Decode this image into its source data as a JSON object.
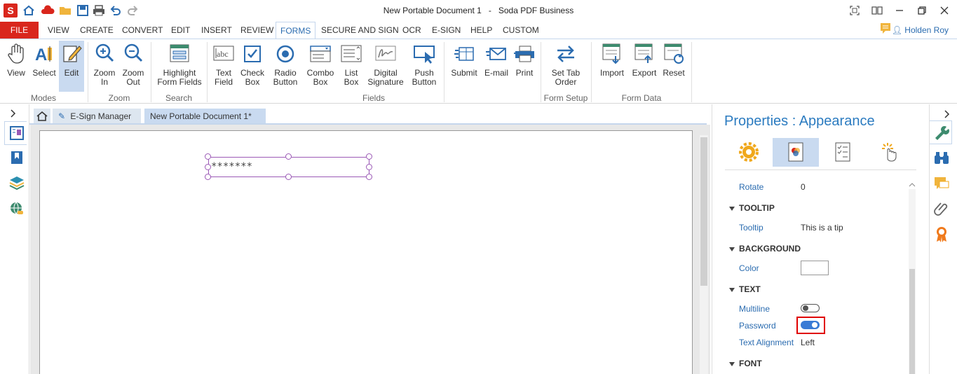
{
  "title_bar": {
    "app_title": "New Portable Document 1",
    "app_suffix": "Soda PDF Business",
    "logo_letter": "S"
  },
  "menu": {
    "file": "FILE",
    "items": [
      "VIEW",
      "CREATE",
      "CONVERT",
      "EDIT",
      "INSERT",
      "REVIEW",
      "FORMS",
      "SECURE AND SIGN",
      "OCR",
      "E-SIGN",
      "HELP",
      "CUSTOM"
    ],
    "active": "FORMS",
    "user": "Holden Roy"
  },
  "ribbon": {
    "buttons": {
      "view": "View",
      "select": "Select",
      "edit": "Edit",
      "zoom_in": "Zoom\nIn",
      "zoom_out": "Zoom\nOut",
      "highlight": "Highlight\nForm Fields",
      "text_field": "Text\nField",
      "check_box": "Check\nBox",
      "radio_button": "Radio\nButton",
      "combo_box": "Combo\nBox",
      "list_box": "List\nBox",
      "digital_signature": "Digital\nSignature",
      "push_button": "Push\nButton",
      "submit": "Submit",
      "email": "E-mail",
      "print": "Print",
      "set_tab_order": "Set Tab\nOrder",
      "import": "Import",
      "export": "Export",
      "reset": "Reset"
    },
    "groups": {
      "modes": "Modes",
      "zoom": "Zoom",
      "search": "Search",
      "fields": "Fields",
      "form_setup": "Form Setup",
      "form_data": "Form Data"
    }
  },
  "tabs": {
    "esign": "E-Sign Manager",
    "doc": "New Portable Document 1*",
    "close": "×"
  },
  "document": {
    "field_value": "*******"
  },
  "properties": {
    "title": "Properties : Appearance",
    "rotate_label": "Rotate",
    "rotate_value": "0",
    "tooltip_section": "TOOLTIP",
    "tooltip_label": "Tooltip",
    "tooltip_value": "This is a tip",
    "background_section": "BACKGROUND",
    "color_label": "Color",
    "text_section": "TEXT",
    "multiline_label": "Multiline",
    "multiline_on": false,
    "password_label": "Password",
    "password_on": true,
    "alignment_label": "Text Alignment",
    "alignment_value": "Left",
    "font_section": "FONT"
  },
  "colors": {
    "brand_red": "#d9261c",
    "accent_blue": "#2b7bc0",
    "toggle_on": "#3a7bd5",
    "highlight_box": "#e00000"
  }
}
